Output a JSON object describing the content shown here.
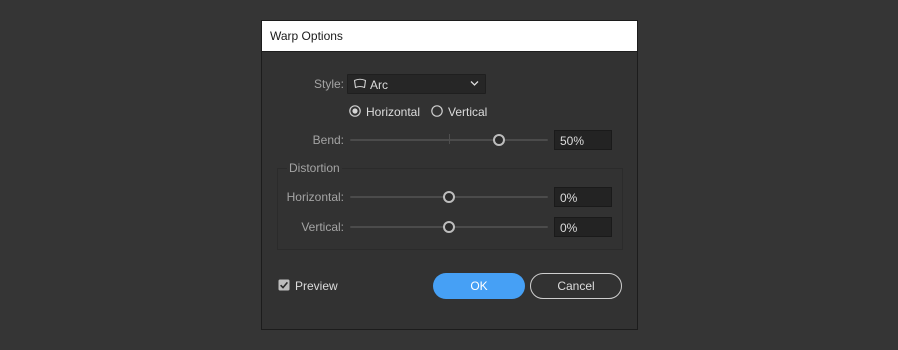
{
  "dialog": {
    "title": "Warp Options"
  },
  "style": {
    "label": "Style:",
    "value": "Arc",
    "icon": "arc-icon"
  },
  "orientation": {
    "options": [
      "Horizontal",
      "Vertical"
    ],
    "selected": "Horizontal"
  },
  "bend": {
    "label": "Bend:",
    "value": "50%",
    "level": 50
  },
  "distortion": {
    "title": "Distortion",
    "horizontal": {
      "label": "Horizontal:",
      "value": "0%",
      "level": 0
    },
    "vertical": {
      "label": "Vertical:",
      "value": "0%",
      "level": 0
    }
  },
  "preview": {
    "label": "Preview",
    "checked": true
  },
  "buttons": {
    "ok": "OK",
    "cancel": "Cancel"
  },
  "colors": {
    "background": "#353535",
    "dialog": "#323232",
    "accent": "#46a0f5"
  }
}
